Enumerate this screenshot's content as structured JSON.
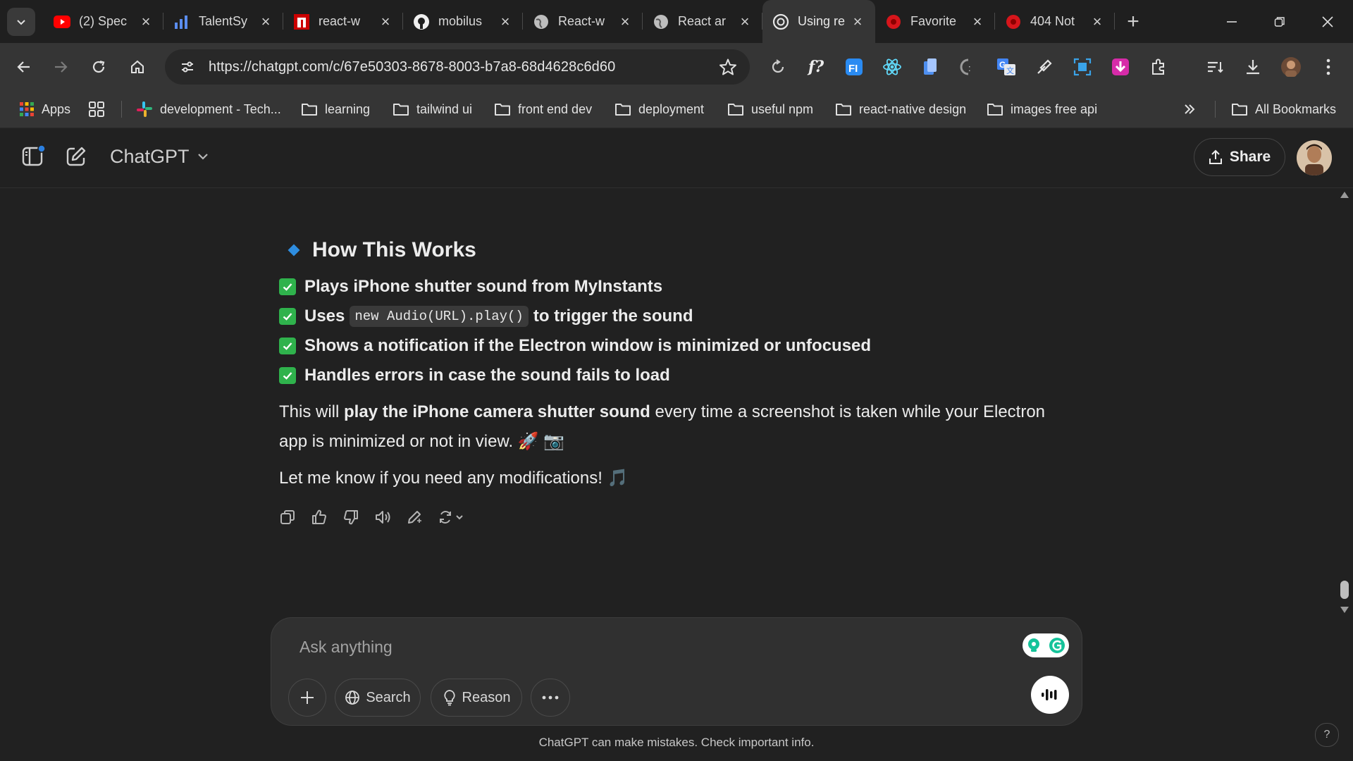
{
  "browser": {
    "tabs": [
      {
        "title": "(2) Spec",
        "favicon": "youtube-icon",
        "active": false
      },
      {
        "title": "TalentSy",
        "favicon": "chart-logo-icon",
        "active": false
      },
      {
        "title": "react-w",
        "favicon": "npm-icon",
        "active": false
      },
      {
        "title": "mobilus",
        "favicon": "github-icon",
        "active": false
      },
      {
        "title": "React-w",
        "favicon": "globe-icon",
        "active": false
      },
      {
        "title": "React ar",
        "favicon": "globe-icon",
        "active": false
      },
      {
        "title": "Using re",
        "favicon": "openai-icon",
        "active": true
      },
      {
        "title": "Favorite",
        "favicon": "record-icon",
        "active": false
      },
      {
        "title": "404 Not",
        "favicon": "record-icon",
        "active": false
      }
    ],
    "url": "https://chatgpt.com/c/67e50303-8678-8003-b7a8-68d4628c6d60",
    "bookmarks": {
      "apps": "Apps",
      "items": [
        "development - Tech...",
        "learning",
        "tailwind ui",
        "front end dev",
        "deployment",
        "useful npm",
        "react-native design",
        "images free api"
      ],
      "all": "All Bookmarks"
    }
  },
  "app": {
    "model_name": "ChatGPT",
    "share_label": "Share"
  },
  "message": {
    "heading": "How This Works",
    "checklist": {
      "item1": "Plays iPhone shutter sound from MyInstants",
      "item2_prefix": "Uses",
      "item2_code": "new Audio(URL).play()",
      "item2_suffix": "to trigger the sound",
      "item3": "Shows a notification if the Electron window is minimized or unfocused",
      "item4": "Handles errors in case the sound fails to load"
    },
    "para1": {
      "prefix": "This will ",
      "bold": "play the iPhone camera shutter sound",
      "suffix": " every time a screenshot is taken while your Electron app is minimized or not in view. 🚀 📷"
    },
    "para2": "Let me know if you need any modifications! 🎵"
  },
  "composer": {
    "placeholder": "Ask anything",
    "search_label": "Search",
    "reason_label": "Reason"
  },
  "footer": {
    "disclaimer": "ChatGPT can make mistakes. Check important info.",
    "help": "?"
  },
  "colors": {
    "background": "#212121",
    "accent_check": "#2fb24c",
    "diamond": "#2e8de0"
  }
}
